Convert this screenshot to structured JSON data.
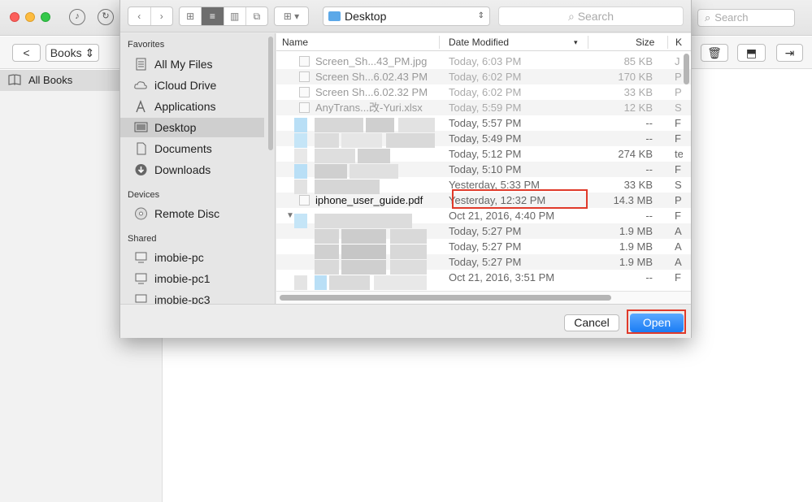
{
  "app": {
    "search_placeholder": "Search",
    "library_popup": "Books",
    "sidebar": {
      "all_books_label": "All Books"
    }
  },
  "dialog": {
    "location": "Desktop",
    "search_placeholder": "Search",
    "sidebar": {
      "favorites_heading": "Favorites",
      "favorites": [
        "All My Files",
        "iCloud Drive",
        "Applications",
        "Desktop",
        "Documents",
        "Downloads"
      ],
      "devices_heading": "Devices",
      "devices": [
        "Remote Disc"
      ],
      "shared_heading": "Shared",
      "shared": [
        "imobie-pc",
        "imobie-pc1",
        "imobie-pc3"
      ],
      "selected": "Desktop"
    },
    "columns": {
      "name": "Name",
      "date": "Date Modified",
      "size": "Size",
      "kind": "K"
    },
    "rows": [
      {
        "name": "Screen_Sh...43_PM.jpg",
        "date": "Today, 6:03 PM",
        "size": "85 KB",
        "kind": "J"
      },
      {
        "name": "Screen Sh...6.02.43 PM",
        "date": "Today, 6:02 PM",
        "size": "170 KB",
        "kind": "P"
      },
      {
        "name": "Screen Sh...6.02.32 PM",
        "date": "Today, 6:02 PM",
        "size": "33 KB",
        "kind": "P"
      },
      {
        "name": "AnyTrans...改-Yuri.xlsx",
        "date": "Today, 5:59 PM",
        "size": "12 KB",
        "kind": "S"
      },
      {
        "name": "",
        "date": "Today, 5:57 PM",
        "size": "--",
        "kind": "F"
      },
      {
        "name": "",
        "date": "Today, 5:49 PM",
        "size": "--",
        "kind": "F"
      },
      {
        "name": "",
        "date": "Today, 5:12 PM",
        "size": "274 KB",
        "kind": "te"
      },
      {
        "name": "",
        "date": "Today, 5:10 PM",
        "size": "--",
        "kind": "F"
      },
      {
        "name": "",
        "date": "Yesterday, 5:33 PM",
        "size": "33 KB",
        "kind": "S"
      },
      {
        "name": "iphone_user_guide.pdf",
        "date": "Yesterday, 12:32 PM",
        "size": "14.3 MB",
        "kind": "P"
      },
      {
        "name": "",
        "date": "Oct 21, 2016, 4:40 PM",
        "size": "--",
        "kind": "F"
      },
      {
        "name": "",
        "date": "Today, 5:27 PM",
        "size": "1.9 MB",
        "kind": "A"
      },
      {
        "name": "",
        "date": "Today, 5:27 PM",
        "size": "1.9 MB",
        "kind": "A"
      },
      {
        "name": "",
        "date": "Today, 5:27 PM",
        "size": "1.9 MB",
        "kind": "A"
      },
      {
        "name": "",
        "date": "Oct 21, 2016, 3:51 PM",
        "size": "--",
        "kind": "F"
      }
    ],
    "cancel_label": "Cancel",
    "open_label": "Open"
  }
}
